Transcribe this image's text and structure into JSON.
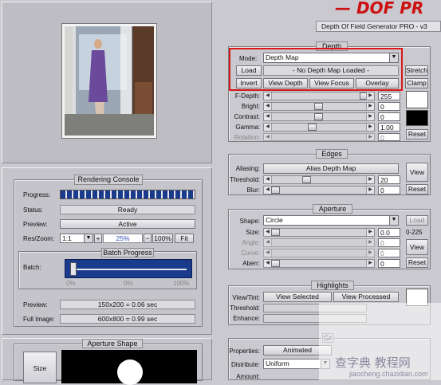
{
  "header": {
    "logo_text": "— DOF PR",
    "title_box": "Depth Of Field Generator PRO - v3"
  },
  "depth": {
    "title": "Depth",
    "mode_label": "Mode:",
    "mode_value": "Depth Map",
    "load_btn": "Load",
    "map_status": "- No Depth Map Loaded -",
    "stretch_btn": "Stretch",
    "invert_btn": "Invert",
    "view_depth_btn": "View Depth",
    "view_focus_btn": "View Focus",
    "overlay_btn": "Overlay",
    "clamp_btn": "Clamp",
    "reset_btn": "Reset",
    "rows": [
      {
        "label": "F-Depth:",
        "value": "255"
      },
      {
        "label": "Bright:",
        "value": "0"
      },
      {
        "label": "Contrast:",
        "value": "0"
      },
      {
        "label": "Gamma:",
        "value": "1.00"
      },
      {
        "label": "Rotation:",
        "value": "0"
      }
    ]
  },
  "edges": {
    "title": "Edges",
    "aliasing_label": "Aliasing:",
    "aliasing_btn": "Alias Depth Map",
    "threshold_label": "Threshold:",
    "threshold_value": "20",
    "blur_label": "Blur:",
    "blur_value": "0",
    "view_btn": "View",
    "reset_btn": "Reset"
  },
  "aperture": {
    "title": "Aperture",
    "shape_label": "Shape:",
    "shape_value": "Circle",
    "load_btn": "Load",
    "size_label": "Size:",
    "size_value": "0.0",
    "size_range": "0-225",
    "angle_label": "Angle:",
    "curve_label": "Curve:",
    "aberr_label": "Aberr:",
    "angle_value": "0",
    "curve_value": "0",
    "aberr_value": "0",
    "view_btn": "View",
    "reset_btn": "Reset"
  },
  "highlights": {
    "title": "Highlights",
    "view_tint_label": "View/Tint:",
    "view_selected_btn": "View Selected",
    "view_processed_btn": "View Processed",
    "threshold_label": "Threshold:",
    "enhance_label": "Enhance:"
  },
  "bottom_group": {
    "title_partial": "Gr",
    "properties_label": "Properties:",
    "properties_btn": "Animated",
    "distribute_label": "Distribute:",
    "distribute_value": "Uniform",
    "amount_label": "Amount:"
  },
  "console": {
    "title": "Rendering Console",
    "progress_label": "Progress:",
    "progress_fraction": 1.0,
    "status_label": "Status:",
    "status_value": "Ready",
    "preview_label": "Preview:",
    "preview_value": "Active",
    "res_zoom_label": "Res/Zoom:",
    "res_value": "1:1",
    "zoom_value": "25%",
    "zoom_100_btn": "100%",
    "fit_btn": "Fit",
    "batch_title": "Batch Progress",
    "batch_label": "Batch:",
    "batch_ticks": [
      "0%",
      "0%",
      "100%"
    ],
    "preview_time_label": "Preview:",
    "preview_time_value": "150x200 = 0.06 sec",
    "full_image_label": "Full Image:",
    "full_image_value": "600x800 = 0.99 sec"
  },
  "aperture_shape": {
    "title": "Aperture Shape",
    "size_btn": "Size"
  },
  "watermark": {
    "text": "查字典 教程网",
    "url": "jiaocheng.chazidian.com"
  },
  "colors": {
    "accent_red": "#cc1010",
    "progress_blue": "#1a3a8c",
    "panel": "#c4c4ca"
  }
}
